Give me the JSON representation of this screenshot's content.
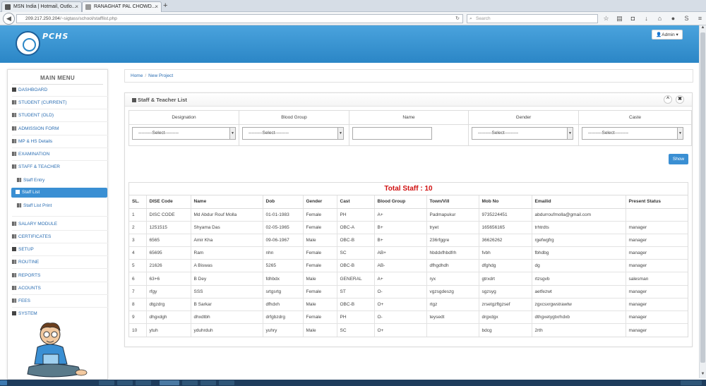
{
  "browser": {
    "tabs": [
      {
        "title": "MSN India | Hotmail, Outlo..."
      },
      {
        "title": "RANAGHAT PAL CHOWD..."
      }
    ],
    "url_host": "209.217.250.204",
    "url_path": "/~sigtass/school/stafflist.php",
    "search_placeholder": "Search"
  },
  "header": {
    "brand": "PCHS",
    "admin_label": "Admin"
  },
  "sidebar": {
    "title": "MAIN MENU",
    "items": [
      {
        "label": "DASHBOARD"
      },
      {
        "label": "STUDENT (CURRENT)"
      },
      {
        "label": "STUDENT (OLD)"
      },
      {
        "label": "ADMISSION FORM"
      },
      {
        "label": "MP & HS Details"
      },
      {
        "label": "EXAMINATION"
      },
      {
        "label": "STAFF & TEACHER"
      },
      {
        "label": "Staff Entry"
      },
      {
        "label": "Staff List"
      },
      {
        "label": "Staff List Print"
      },
      {
        "label": "SALARY MODULE"
      },
      {
        "label": "CERTIFICATES"
      },
      {
        "label": "SETUP"
      },
      {
        "label": "ROUTINE"
      },
      {
        "label": "REPORTS"
      },
      {
        "label": "ACOUNTS"
      },
      {
        "label": "FEES"
      },
      {
        "label": "SYSTEM"
      }
    ]
  },
  "breadcrumb": [
    "Home",
    "New Project"
  ],
  "panel": {
    "title": "Staff & Teacher List",
    "collapse_glyph": "^",
    "close_glyph": "✖",
    "filters": {
      "designation": {
        "label": "Designation",
        "value": "---------Select---------"
      },
      "blood_group": {
        "label": "Blood Group",
        "value": "---------Select---------"
      },
      "name": {
        "label": "Name",
        "value": ""
      },
      "gender": {
        "label": "Gender",
        "value": "---------Select---------"
      },
      "caste": {
        "label": "Caste",
        "value": "---------Select---------"
      }
    },
    "show_label": "Show",
    "total_label": "Total Staff : 10",
    "columns": [
      "SL.",
      "DISE Code",
      "Name",
      "Dob",
      "Gender",
      "Cast",
      "Blood Group",
      "Town/Vill",
      "Mob No",
      "Emailid",
      "Present Status"
    ],
    "rows": [
      [
        "1",
        "DISC CODE",
        "Md Abdur Rouf Molla",
        "01-01-1983",
        "Female",
        "PH",
        "A+",
        "Padmapukur",
        "9735224451",
        "abdurroufmolla@gmail.com",
        ""
      ],
      [
        "2",
        "1251515",
        "Shyama Das",
        "02-05-1965",
        "Female",
        "OBC-A",
        "B+",
        "tryet",
        "165656165",
        "trhtrdts",
        "manager"
      ],
      [
        "3",
        "6565",
        "Amir Kha",
        "09-06-1967",
        "Male",
        "OBC-B",
        "B+",
        "236rfggre",
        "36626262",
        "rgefwgfrg",
        "manager"
      ],
      [
        "4",
        "65695",
        "Ram",
        "nhn",
        "Female",
        "SC",
        "AB+",
        "hbddxfhbdfrh",
        "fvbh",
        "fbhdbg",
        "manager"
      ],
      [
        "5",
        "21626",
        "A Biswas",
        "5265",
        "Female",
        "OBC-B",
        "AB-",
        "dfhgdhdh",
        "dfghdg",
        "dg",
        "manager"
      ],
      [
        "6",
        "63+6",
        "B Dey",
        "fdhbdx",
        "Male",
        "GENERAL",
        "A+",
        "ryx",
        "gtrxdrt",
        "rtzsgvb",
        "salesman"
      ],
      [
        "7",
        "rfgy",
        "SSS",
        "srtgsrtg",
        "Female",
        "ST",
        "O-",
        "vgzsgdeszg",
        "sgzsyg",
        "aetfezwt",
        "manager"
      ],
      [
        "8",
        "dtgzdrg",
        "B Sarkar",
        "dfhdxh",
        "Male",
        "OBC-B",
        "O+",
        "rtgz",
        "zrsetgzftgzsef",
        "zgxcsxrgwstrawtw",
        "manager"
      ],
      [
        "9",
        "dhgxdgh",
        "dhxdtbh",
        "drfgbzdrg",
        "Female",
        "PH",
        "O-",
        "teysedt",
        "drgxdgx",
        "dthgxetygtxrhdxb",
        "manager"
      ],
      [
        "10",
        "ytuh",
        "yduhrduh",
        "yuhry",
        "Male",
        "SC",
        "O+",
        "",
        "bdcg",
        "2rth",
        "manager"
      ]
    ]
  },
  "colors": {
    "header_blue": "#2b86c6",
    "active_blue": "#3a8fd3",
    "total_red": "#d01010"
  }
}
